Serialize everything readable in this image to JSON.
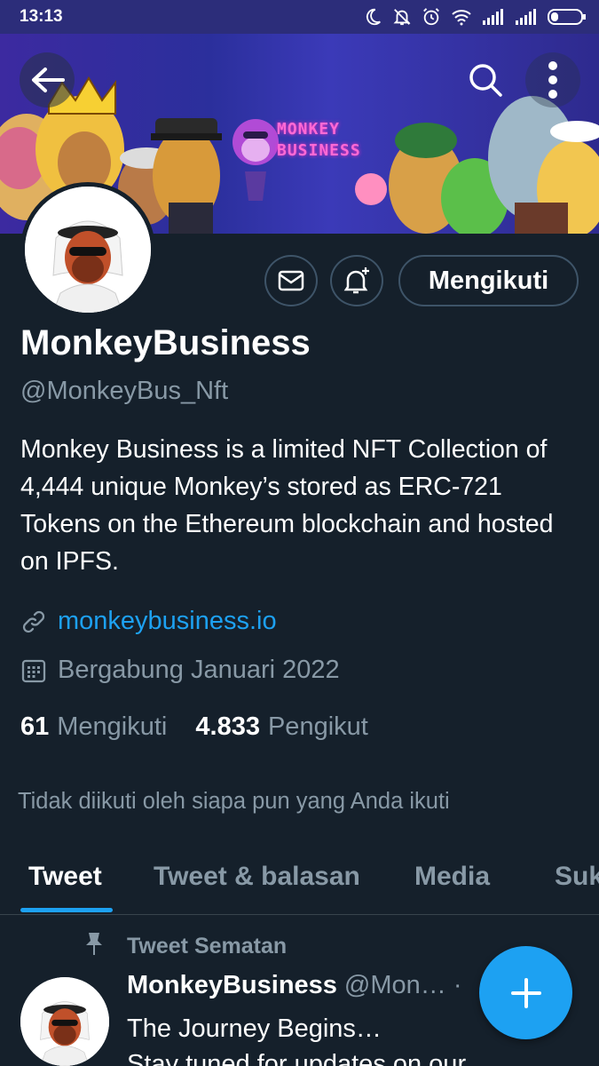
{
  "status_bar": {
    "time": "13:13"
  },
  "banner": {
    "logo_line1": "MONKEY",
    "logo_line2": "BUSINESS"
  },
  "profile": {
    "display_name": "MonkeyBusiness",
    "handle": "@MonkeyBus_Nft",
    "bio": "Monkey Business is a limited NFT Collection of 4,444 unique Monkey’s stored as ERC-721 Tokens on the Ethereum blockchain and hosted on IPFS.",
    "website": "monkeybusiness.io",
    "joined": "Bergabung Januari 2022",
    "following_count": "61",
    "following_label": "Mengikuti",
    "followers_count": "4.833",
    "followers_label": "Pengikut",
    "followed_by_note": "Tidak diikuti oleh siapa pun yang Anda ikuti"
  },
  "actions": {
    "follow_label": "Mengikuti"
  },
  "tabs": [
    {
      "label": "Tweet",
      "active": true
    },
    {
      "label": "Tweet & balasan",
      "active": false
    },
    {
      "label": "Media",
      "active": false
    },
    {
      "label": "Suka",
      "active": false
    }
  ],
  "pinned_tweet": {
    "pinned_label": "Tweet Sematan",
    "author_name": "MonkeyBusiness",
    "author_handle": "@Mon… ·",
    "text_line1": "The Journey Begins…",
    "text_line2": "Stay tuned for updates on our"
  },
  "colors": {
    "accent": "#1da1f2",
    "background": "#15202b",
    "muted": "#8899a6",
    "status_bar": "#2c2d7a"
  }
}
